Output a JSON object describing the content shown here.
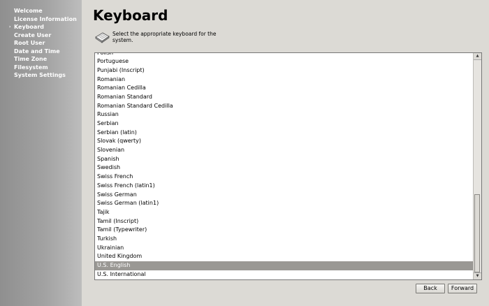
{
  "sidebar": {
    "items": [
      {
        "label": "Welcome",
        "current": false
      },
      {
        "label": "License Information",
        "current": false
      },
      {
        "label": "Keyboard",
        "current": true
      },
      {
        "label": "Create User",
        "current": false
      },
      {
        "label": "Root User",
        "current": false
      },
      {
        "label": "Date and Time",
        "current": false
      },
      {
        "label": "Time Zone",
        "current": false
      },
      {
        "label": "Filesystem",
        "current": false
      },
      {
        "label": "System Settings",
        "current": false
      }
    ],
    "current_marker": "›"
  },
  "page": {
    "title": "Keyboard",
    "hint": "Select the appropriate keyboard for the system.",
    "hint_icon": "keyboard-icon"
  },
  "keyboard_list": {
    "items": [
      "Polish",
      "Portuguese",
      "Punjabi (Inscript)",
      "Romanian",
      "Romanian Cedilla",
      "Romanian Standard",
      "Romanian Standard Cedilla",
      "Russian",
      "Serbian",
      "Serbian (latin)",
      "Slovak (qwerty)",
      "Slovenian",
      "Spanish",
      "Swedish",
      "Swiss French",
      "Swiss French (latin1)",
      "Swiss German",
      "Swiss German (latin1)",
      "Tajik",
      "Tamil (Inscript)",
      "Tamil (Typewriter)",
      "Turkish",
      "Ukrainian",
      "United Kingdom",
      "U.S. English",
      "U.S. International"
    ],
    "selected": "U.S. English",
    "selection_color": "#9a9894"
  },
  "buttons": {
    "back": "Back",
    "forward": "Forward"
  }
}
